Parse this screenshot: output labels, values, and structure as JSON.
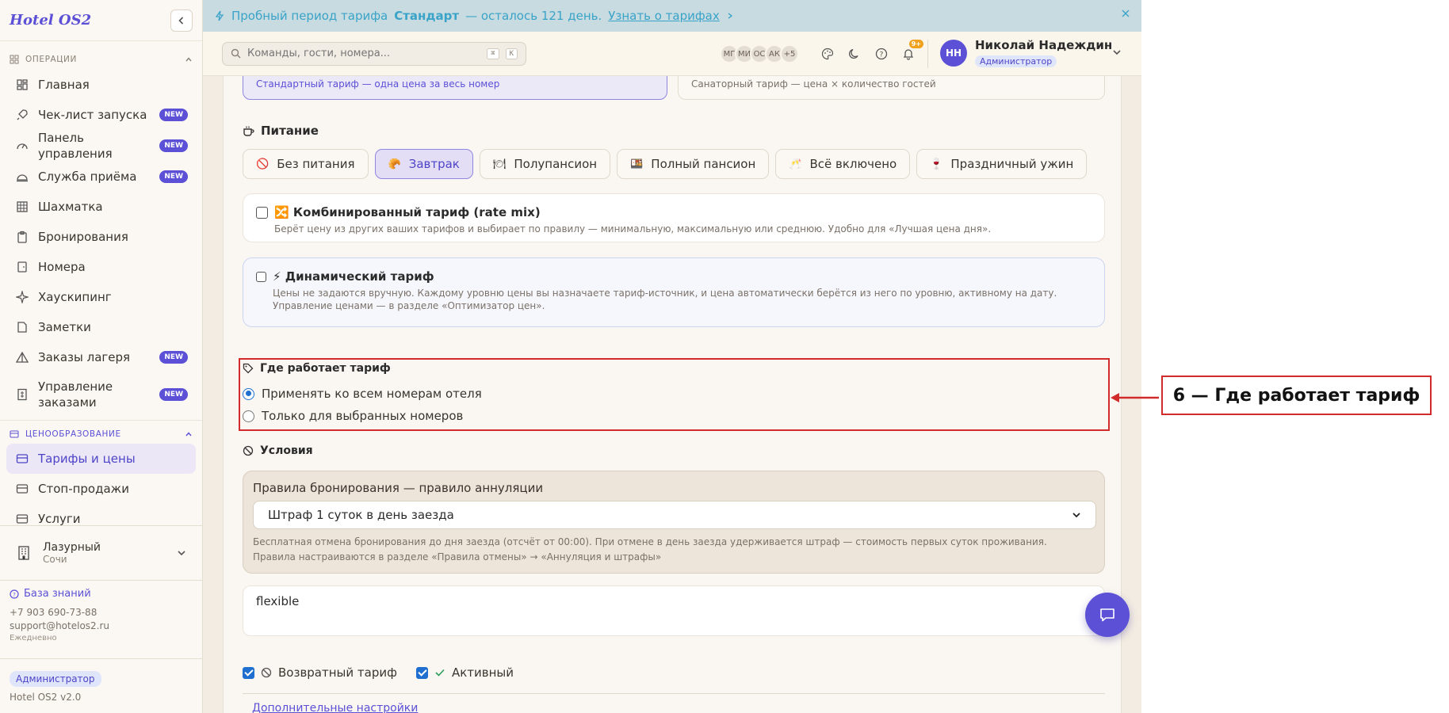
{
  "app": {
    "logo": "Hotel OS2"
  },
  "sidebar": {
    "section_ops": "ОПЕРАЦИИ",
    "items": [
      {
        "label": "Главная",
        "badge": ""
      },
      {
        "label": "Чек-лист запуска",
        "badge": "NEW"
      },
      {
        "label": "Панель управления",
        "badge": "NEW"
      },
      {
        "label": "Служба приёма",
        "badge": "NEW"
      },
      {
        "label": "Шахматка",
        "badge": ""
      },
      {
        "label": "Бронирования",
        "badge": ""
      },
      {
        "label": "Номера",
        "badge": ""
      },
      {
        "label": "Хаускипинг",
        "badge": ""
      },
      {
        "label": "Заметки",
        "badge": ""
      },
      {
        "label": "Заказы лагеря",
        "badge": "NEW"
      },
      {
        "label": "Управление заказами",
        "badge": "NEW"
      }
    ],
    "section_pricing": "ЦЕНООБРАЗОВАНИЕ",
    "pricing_items": [
      {
        "label": "Тарифы и цены"
      },
      {
        "label": "Стоп-продажи"
      },
      {
        "label": "Услуги"
      }
    ],
    "hotel": {
      "name": "Лазурный",
      "city": "Сочи"
    },
    "contacts": {
      "kb": "База знаний",
      "phone": "+7 903 690-73-88",
      "email": "support@hotelos2.ru",
      "schedule": "Ежедневно"
    },
    "role": "Администратор",
    "version": "Hotel OS2 v2.0"
  },
  "trial": {
    "prefix": "Пробный период тарифа",
    "plan": "Стандарт",
    "suffix": "— осталось 121 день.",
    "link": "Узнать о тарифах"
  },
  "topbar": {
    "search_placeholder": "Команды, гости, номера...",
    "kbd1": "⌘",
    "kbd2": "K",
    "avatars": [
      "МГ",
      "МИ",
      "ОС",
      "АК",
      "+5"
    ],
    "notif_count": "9+",
    "user": {
      "initials": "НН",
      "name": "Николай Надеждин",
      "role": "Администратор"
    }
  },
  "rate_types": {
    "standard_desc": "Стандартный тариф — одна цена за весь номер",
    "sanatorium_desc": "Санаторный тариф — цена × количество гостей"
  },
  "meals": {
    "title": "Питание",
    "options": [
      {
        "label": "Без питания",
        "icon": "🚫"
      },
      {
        "label": "Завтрак",
        "icon": "🥐"
      },
      {
        "label": "Полупансион",
        "icon": "🍽"
      },
      {
        "label": "Полный пансион",
        "icon": "🍱"
      },
      {
        "label": "Всё включено",
        "icon": "🥂"
      },
      {
        "label": "Праздничный ужин",
        "icon": "🍷"
      }
    ],
    "selected": "Завтрак"
  },
  "rate_mix": {
    "title": "🔀 Комбинированный тариф (rate mix)",
    "desc": "Берёт цену из других ваших тарифов и выбирает по правилу — минимальную, максимальную или среднюю. Удобно для «Лучшая цена дня».",
    "checked": false
  },
  "dynamic": {
    "title": "⚡ Динамический тариф",
    "desc": "Цены не задаются вручную. Каждому уровню цены вы назначаете тариф-источник, и цена автоматически берётся из него по уровню, активному на дату. Управление ценами — в разделе «Оптимизатор цен».",
    "checked": false
  },
  "where": {
    "title": "Где работает тариф",
    "opt_all": "Применять ко всем номерам отеля",
    "opt_selected": "Только для выбранных номеров",
    "selected": "all"
  },
  "conditions": {
    "title": "Условия",
    "label": "Правила бронирования — правило аннуляции",
    "select_value": "Штраф 1 суток в день заезда",
    "note1": "Бесплатная отмена бронирования до дня заезда (отсчёт от 00:00). При отмене в день заезда удерживается штраф — стоимость первых суток проживания.",
    "note2": "Правила настраиваются в разделе «Правила отмены» → «Аннуляция и штрафы»"
  },
  "code_field": {
    "value": "flexible"
  },
  "flags": {
    "refundable": "Возвратный тариф",
    "active": "Активный"
  },
  "more_settings": "Дополнительные настройки",
  "annotation": {
    "label": "6 — Где работает тариф"
  },
  "colors": {
    "accent": "#5b50d6",
    "annotation": "#d12b2b",
    "banner": "#c7dbe0"
  }
}
